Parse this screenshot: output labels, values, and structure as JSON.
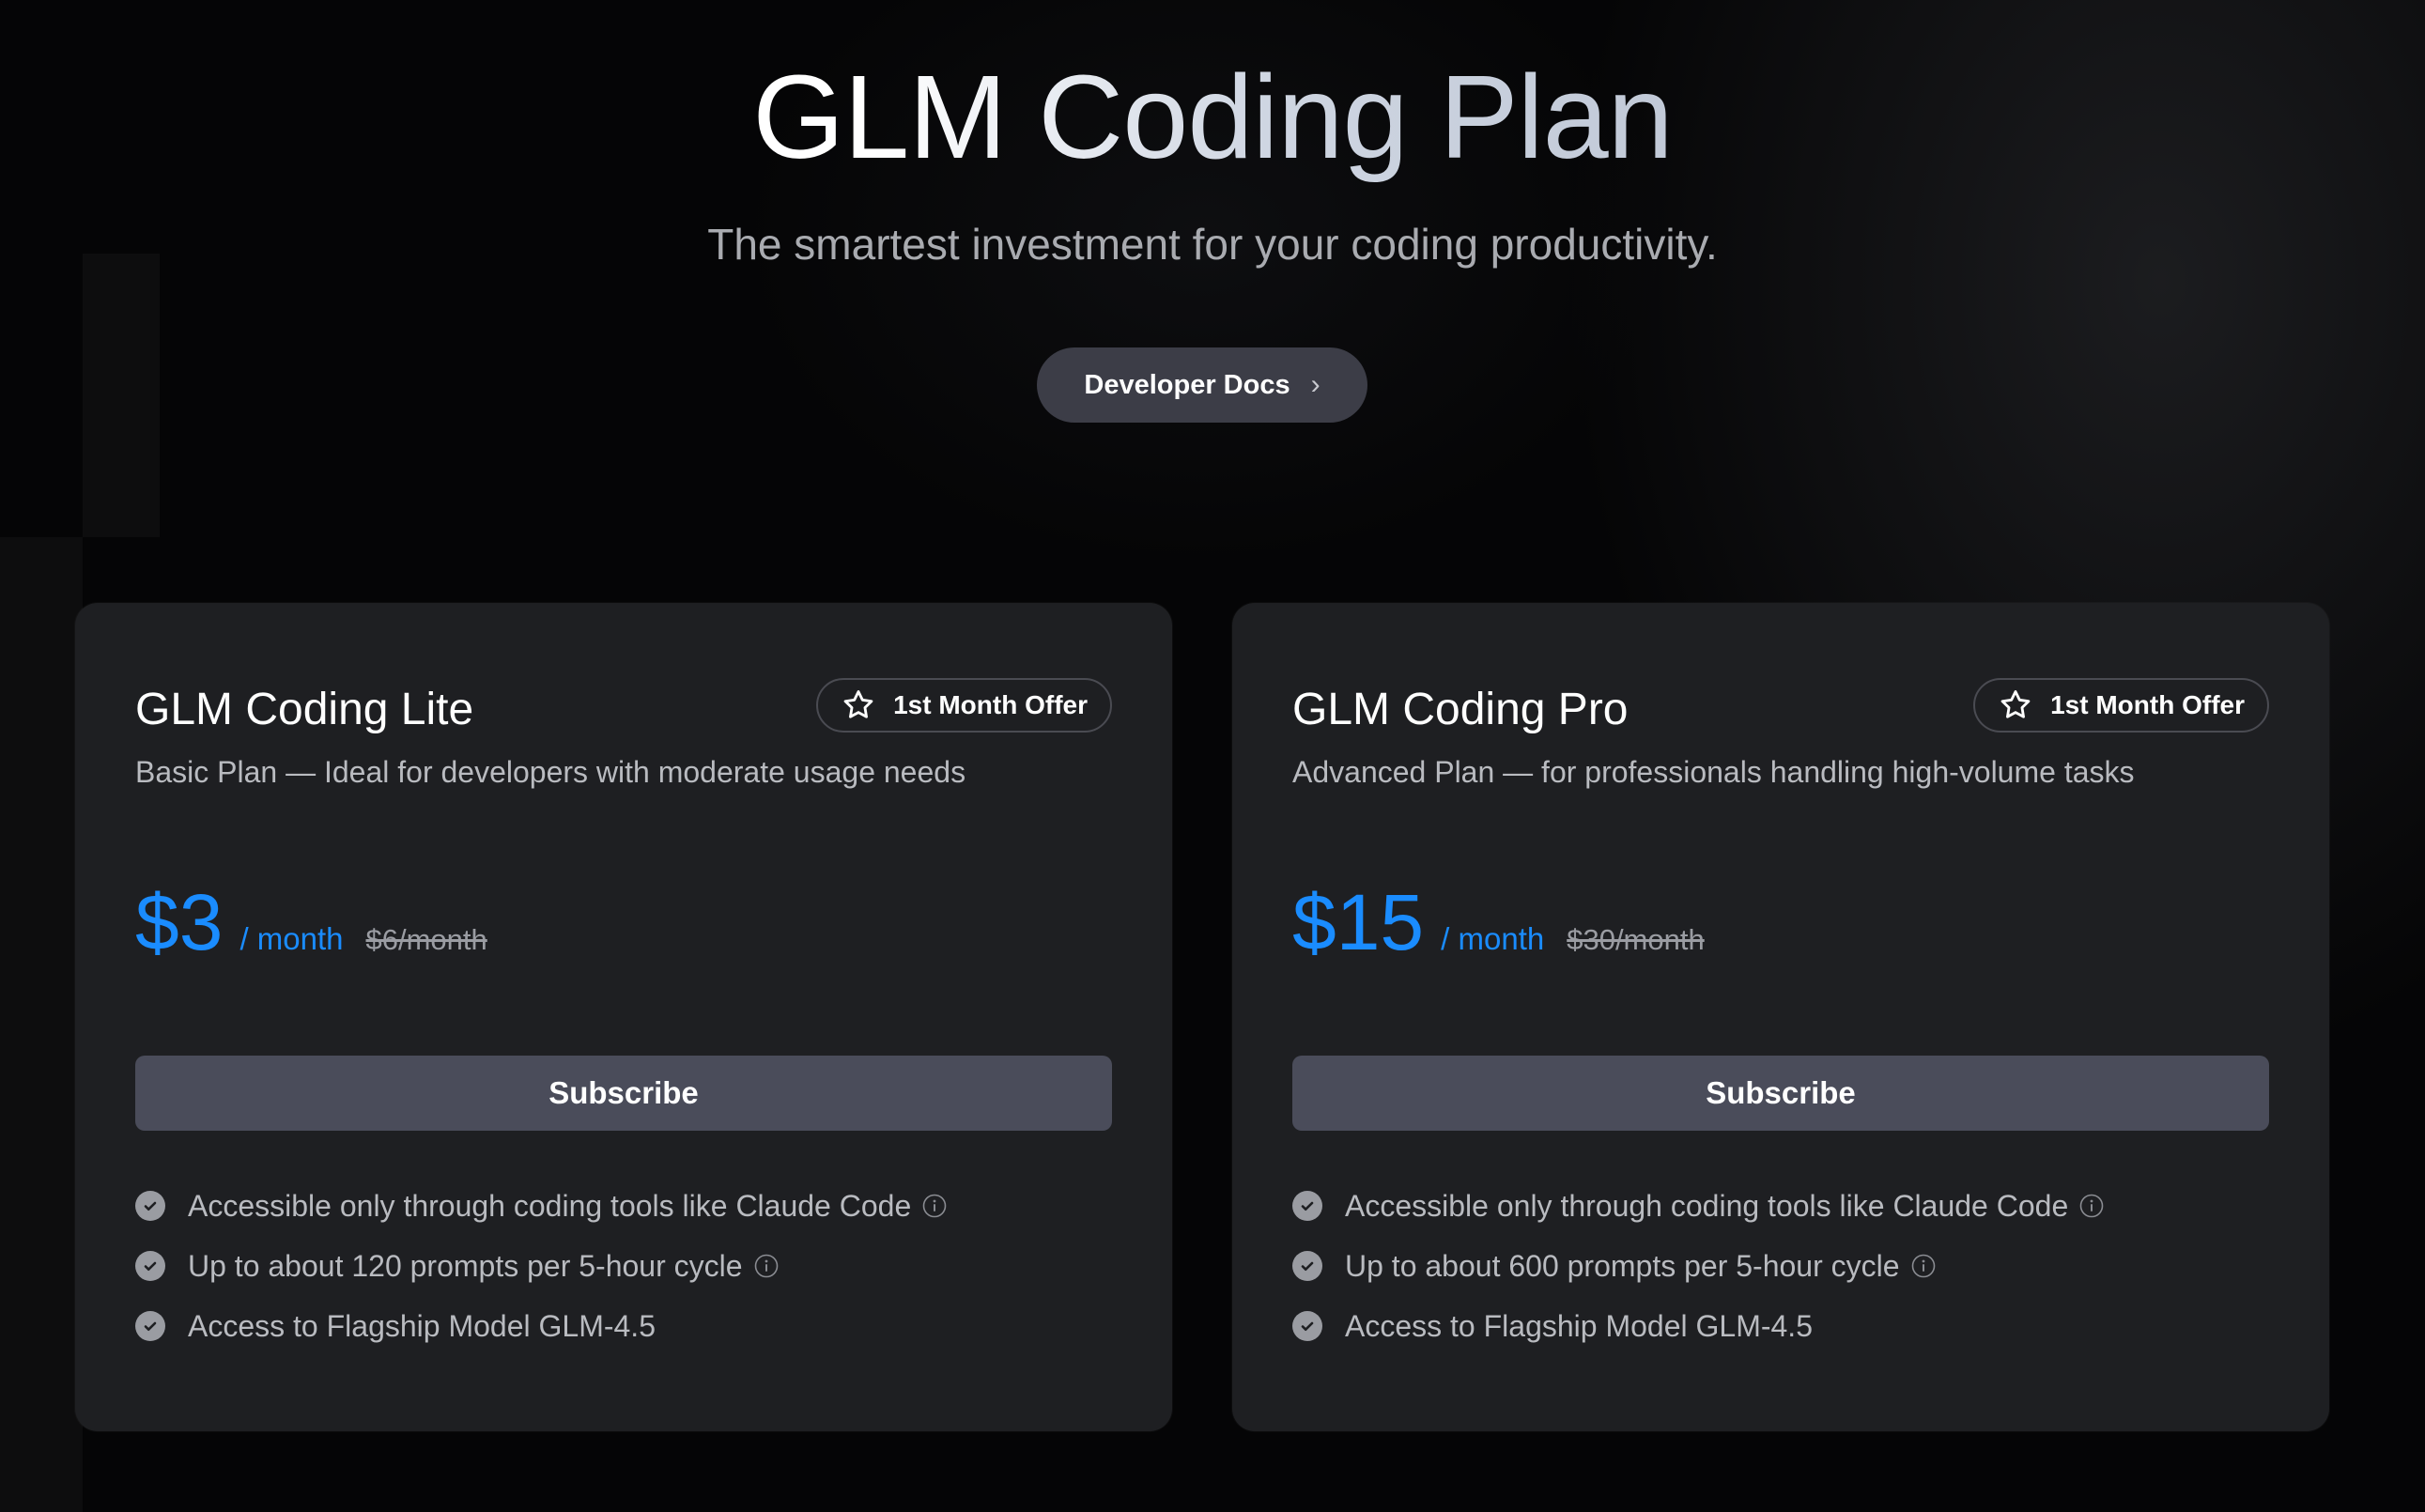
{
  "hero": {
    "title": "GLM Coding Plan",
    "subtitle": "The smartest investment for your coding productivity.",
    "docs_button": {
      "label": "Developer Docs",
      "icon": "chevron-right-icon"
    }
  },
  "colors": {
    "page_background": "#050506",
    "card_background": "#1e1f22",
    "accent_price": "#1a8cff",
    "button_background": "#4a4c5a",
    "docs_button_background": "#3c3d47"
  },
  "plans": [
    {
      "title": "GLM Coding Lite",
      "badge": {
        "label": "1st Month Offer",
        "icon": "star-icon"
      },
      "description": "Basic Plan — Ideal for developers with moderate usage needs",
      "price": "$3",
      "period": "/ month",
      "original_price": "$6/month",
      "subscribe_label": "Subscribe",
      "features": [
        {
          "text": "Accessible only through coding tools like Claude Code",
          "info": true
        },
        {
          "text": "Up to about 120 prompts per 5-hour cycle",
          "info": true
        },
        {
          "text": "Access to Flagship Model GLM-4.5",
          "info": false
        }
      ]
    },
    {
      "title": "GLM Coding Pro",
      "badge": {
        "label": "1st Month Offer",
        "icon": "star-icon"
      },
      "description": "Advanced Plan — for professionals handling high-volume tasks",
      "price": "$15",
      "period": "/ month",
      "original_price": "$30/month",
      "subscribe_label": "Subscribe",
      "features": [
        {
          "text": "Accessible only through coding tools like Claude Code",
          "info": true
        },
        {
          "text": "Up to about 600 prompts per 5-hour cycle",
          "info": true
        },
        {
          "text": "Access to Flagship Model GLM-4.5",
          "info": false
        }
      ]
    }
  ]
}
